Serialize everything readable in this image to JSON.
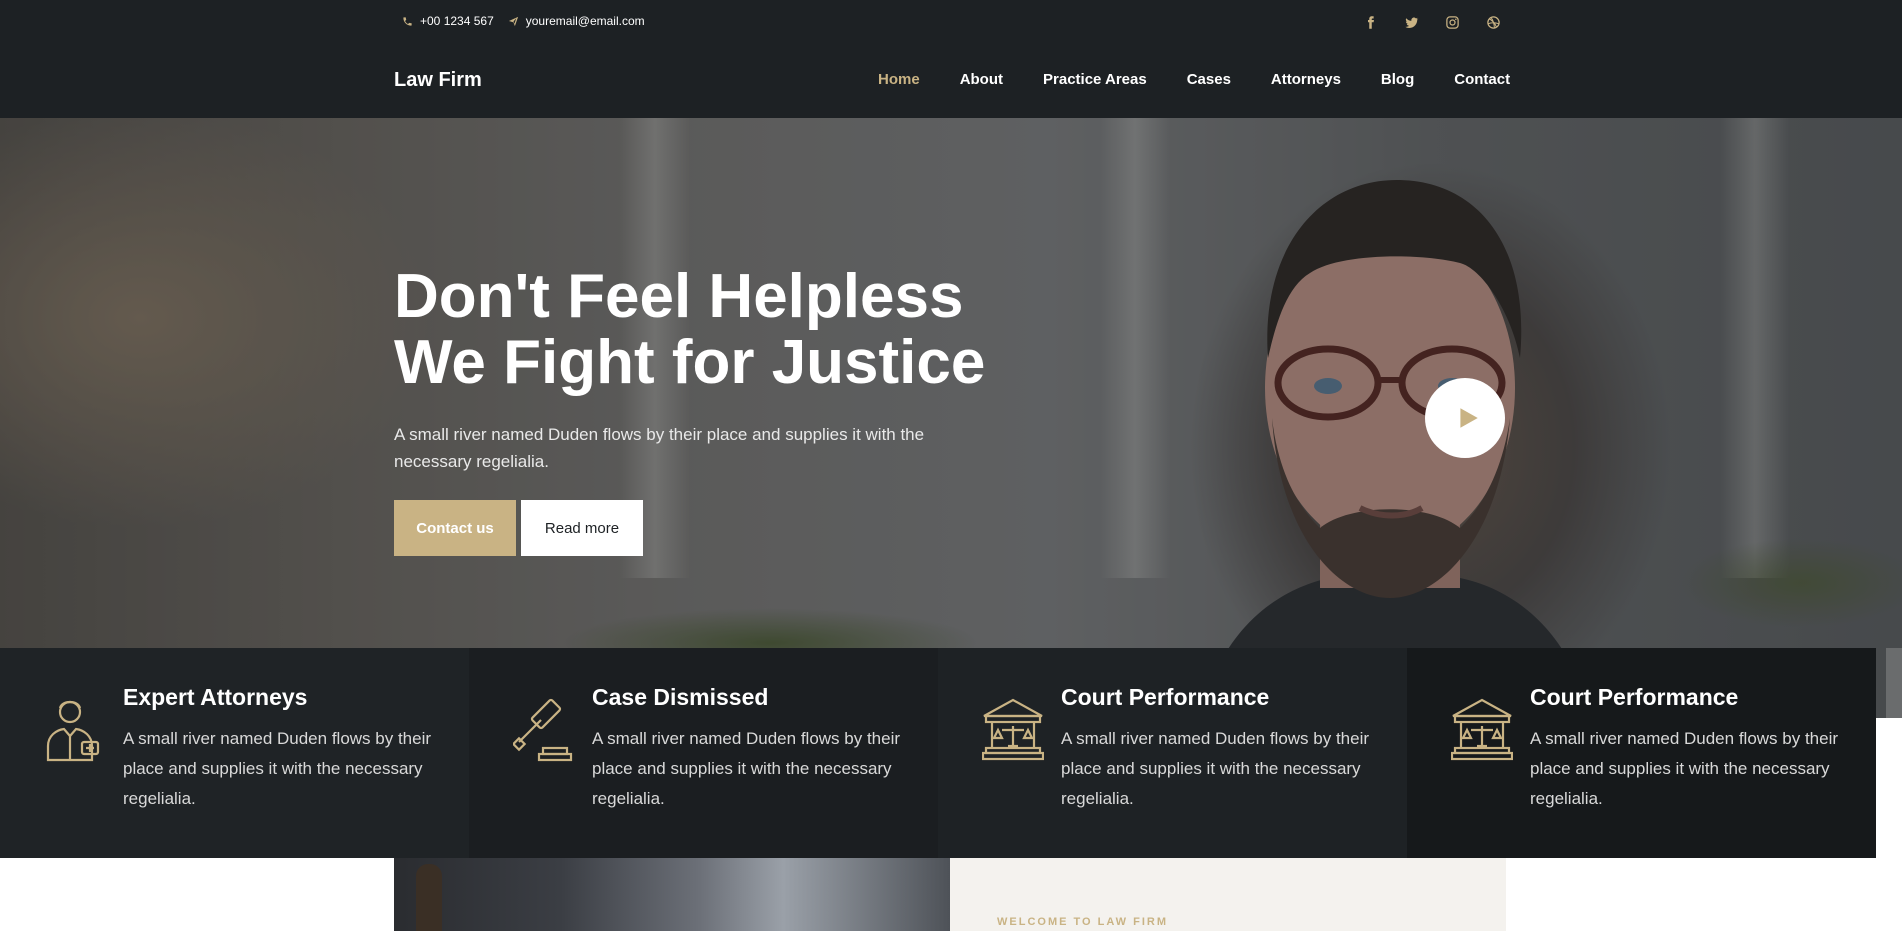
{
  "colors": {
    "accent": "#c9b384",
    "header_bg": "#1d2124",
    "feature_bg": "#1f2326",
    "text_light": "#ffffff"
  },
  "topbar": {
    "phone": {
      "icon": "phone-icon",
      "text": "+00 1234 567"
    },
    "email": {
      "icon": "paper-plane-icon",
      "text": "youremail@email.com"
    },
    "social": [
      {
        "name": "facebook-icon"
      },
      {
        "name": "twitter-icon"
      },
      {
        "name": "instagram-icon"
      },
      {
        "name": "dribbble-icon"
      }
    ]
  },
  "navbar": {
    "brand": "Law Firm",
    "links": [
      {
        "label": "Home",
        "active": true
      },
      {
        "label": "About"
      },
      {
        "label": "Practice Areas"
      },
      {
        "label": "Cases"
      },
      {
        "label": "Attorneys"
      },
      {
        "label": "Blog"
      },
      {
        "label": "Contact"
      }
    ]
  },
  "hero": {
    "title_line1": "Don't Feel Helpless",
    "title_line2": "We Fight for Justice",
    "subtitle": "A small river named Duden flows by their place and supplies it with the necessary regelialia.",
    "primary_button": "Contact us",
    "secondary_button": "Read more",
    "play_icon": "play-icon"
  },
  "features": [
    {
      "icon": "attorney-icon",
      "title": "Expert Attorneys",
      "text": "A small river named Duden flows by their place and supplies it with the necessary regelialia."
    },
    {
      "icon": "gavel-icon",
      "title": "Case Dismissed",
      "text": "A small river named Duden flows by their place and supplies it with the necessary regelialia."
    },
    {
      "icon": "courthouse-icon",
      "title": "Court Performance",
      "text": "A small river named Duden flows by their place and supplies it with the necessary regelialia."
    },
    {
      "icon": "courthouse-icon",
      "title": "Court Performance",
      "text": "A small river named Duden flows by their place and supplies it with the necessary regelialia."
    }
  ],
  "welcome": {
    "tag": "WELCOME TO LAW FIRM"
  }
}
